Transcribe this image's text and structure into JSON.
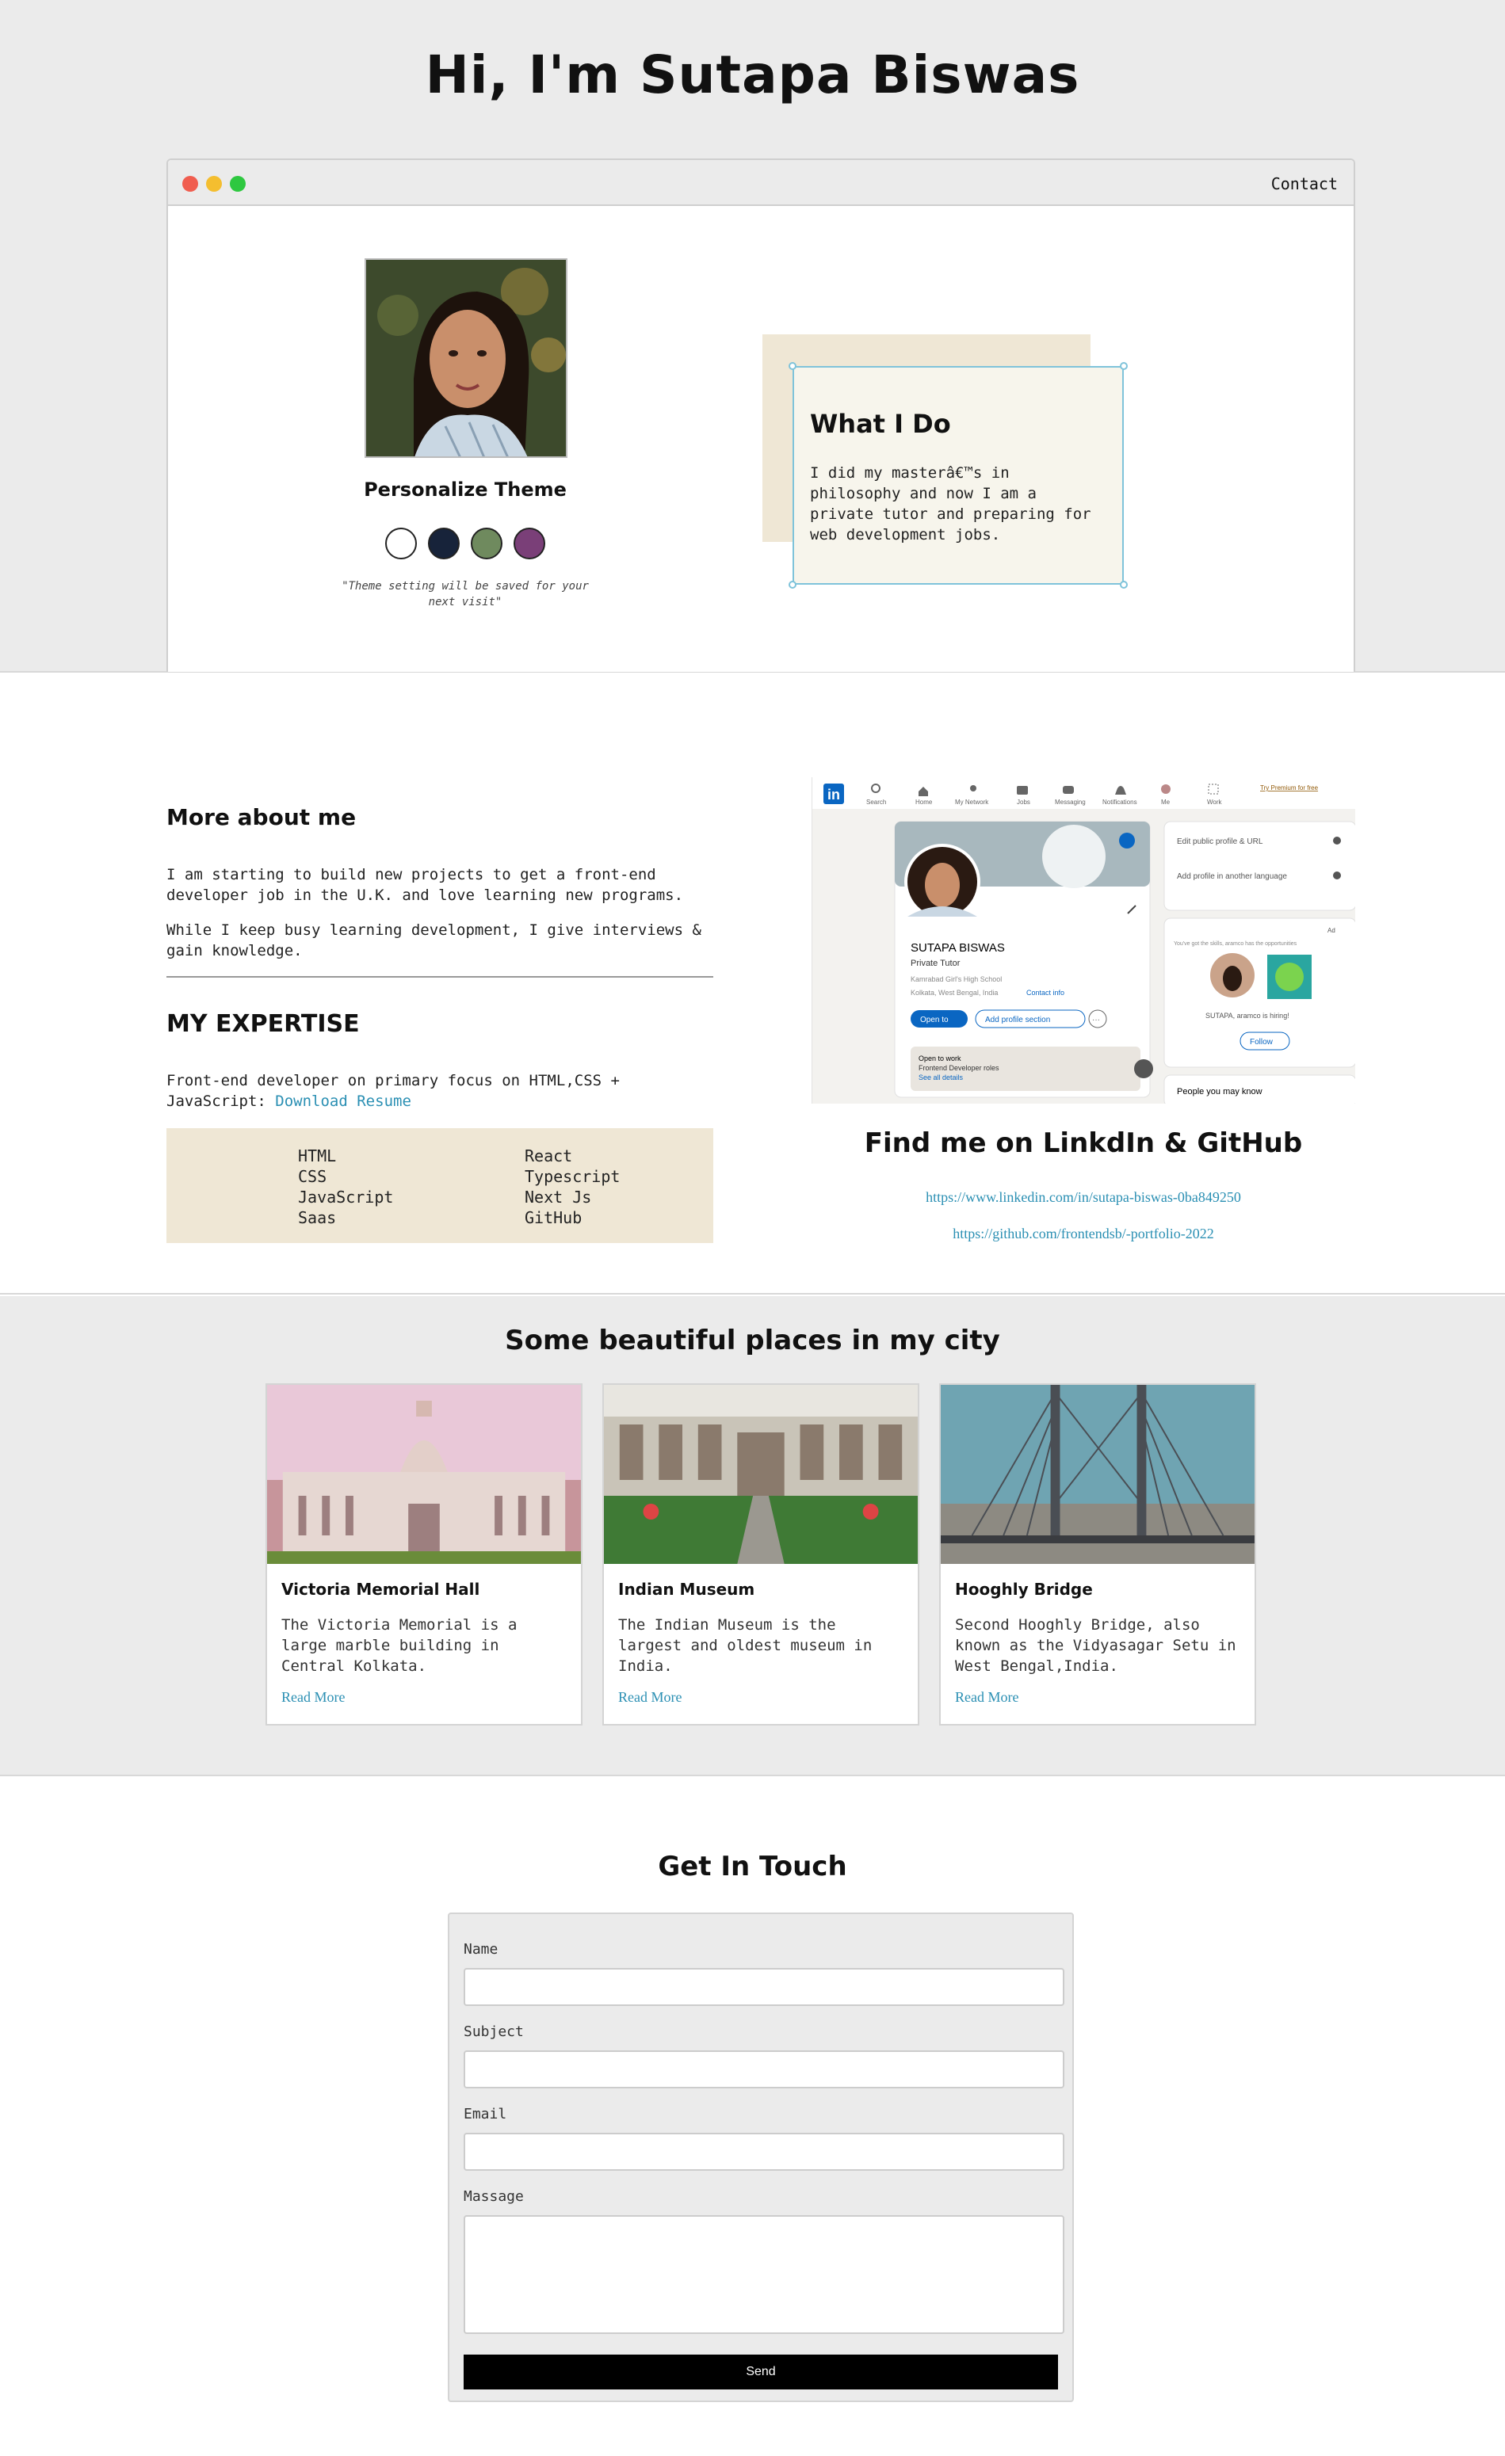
{
  "hero": {
    "title": "Hi, I'm Sutapa Biswas",
    "nav_contact": "Contact",
    "theme_title": "Personalize Theme",
    "theme_note": "\"Theme setting will be saved for your next visit\"",
    "theme_colors": [
      "#ffffff",
      "#17233a",
      "#6f8a5e",
      "#7a3f78"
    ],
    "what_title": "What I Do",
    "what_text": "I did my masterâ€™s in philosophy and now I am a private tutor and preparing for web development jobs."
  },
  "about": {
    "more_title": "More about me",
    "p1": "I am starting to build new projects to get a front-end developer job in the U.K. and love learning new programs.",
    "p2": "While I keep busy learning development, I give interviews & gain knowledge.",
    "expertise_title": "MY EXPERTISE",
    "expertise_text": "Front-end developer on primary focus on HTML,CSS + JavaScript:",
    "resume_label": "Download Resume",
    "skills_left": [
      "HTML",
      "CSS",
      "JavaScript",
      "Saas"
    ],
    "skills_right": [
      "React",
      "Typescript",
      "Next Js",
      "GitHub"
    ],
    "find_title": "Find me on LinkdIn & GitHub",
    "linkedin_url": "https://www.linkedin.com/in/sutapa-biswas-0ba849250",
    "github_url": "https://github.com/frontendsb/-portfolio-2022"
  },
  "linkedin_shot": {
    "nav": [
      "Search",
      "Home",
      "My Network",
      "Jobs",
      "Messaging",
      "Notifications",
      "Me",
      "Work"
    ],
    "premium": "Try Premium for free",
    "name": "SUTAPA BISWAS",
    "headline": "Private Tutor",
    "school": "Kamrabad Girl's High School",
    "location": "Kolkata, West Bengal, India",
    "contact_info": "Contact info",
    "open_to": "Open to",
    "add_section": "Add profile section",
    "otw_title": "Open to work",
    "otw_roles": "Frontend Developer roles",
    "otw_link": "See all details",
    "side_edit": "Edit public profile & URL",
    "side_lang": "Add profile in another language",
    "ad_label": "Ad",
    "ad_note": "You've got the skills, aramco has the opportunities",
    "ad_hiring": "SUTAPA, aramco is hiring!",
    "follow": "Follow",
    "people": "People you may know"
  },
  "places": {
    "title": "Some beautiful places in my city",
    "cards": [
      {
        "title": "Victoria Memorial Hall",
        "text": "The Victoria Memorial is a large marble building in Central Kolkata.",
        "link": "Read More"
      },
      {
        "title": "Indian Museum",
        "text": "The Indian Museum is the largest and oldest museum in India.",
        "link": "Read More"
      },
      {
        "title": "Hooghly Bridge",
        "text": "Second Hooghly Bridge, also known as the Vidyasagar Setu in West Bengal,India.",
        "link": "Read More"
      }
    ]
  },
  "contact": {
    "title": "Get In Touch",
    "name_label": "Name",
    "subject_label": "Subject",
    "email_label": "Email",
    "message_label": "Massage",
    "send_label": "Send"
  }
}
